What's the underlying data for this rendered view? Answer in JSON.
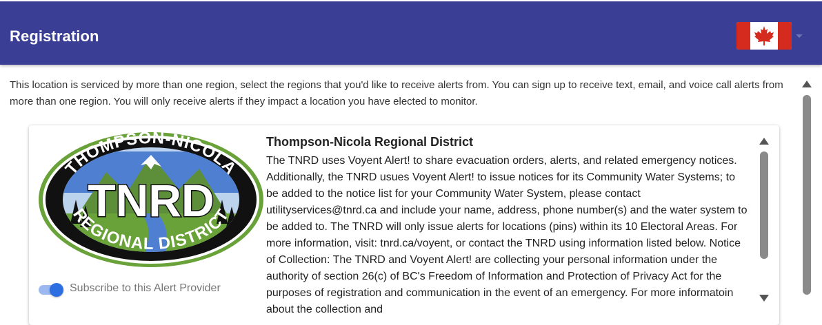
{
  "header": {
    "title": "Registration",
    "country_flag": "canada-flag-icon"
  },
  "intro_text": "This location is serviced by more than one region, select the regions that you'd like to receive alerts from. You can sign up to receive text, email, and voice call alerts from more than one region. You will only receive alerts if they impact a location you have elected to monitor.",
  "providers": [
    {
      "name": "Thompson-Nicola Regional District",
      "logo": {
        "top_text": "THOMPSON-NICOLA",
        "center_text": "TNRD",
        "bottom_text": "REGIONAL DISTRICT"
      },
      "subscribe_label": "Subscribe to this Alert Provider",
      "subscribed": true,
      "description": "The TNRD uses Voyent Alert! to share evacuation orders, alerts, and related emergency notices. Additionally, the TNRD usues Voyent Alert! to issue notices for its Community Water Systems; to be added to the notice list for your Community Water System, please contact utilityservices@tnrd.ca and include your name, address, phone number(s) and the water system to be added to. The TNRD will only issue alerts for locations (pins) within its 10 Electoral Areas. For more information, visit: tnrd.ca/voyent, or contact the TNRD using information listed below. Notice of Collection: The TNRD and Voyent Alert! are collecting your personal information under the authority of section 26(c) of BC's Freedom of Information and Protection of Privacy Act for the purposes of registration and communication in the event of an emergency. For more informatoin about the collection and"
    }
  ],
  "colors": {
    "header_bg": "#3a3f95",
    "toggle_on": "#2d6fe0",
    "logo_green": "#6aa23a",
    "logo_black": "#111111"
  }
}
